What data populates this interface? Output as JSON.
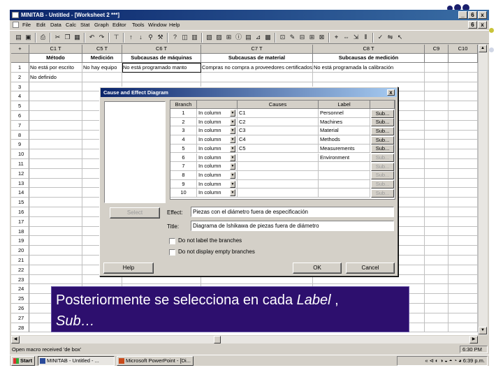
{
  "window": {
    "title": "MINITAB - Untitled - [Worksheet 2 ***]",
    "controls": [
      "_",
      "6",
      "x"
    ]
  },
  "menubar": {
    "items": [
      "File",
      "Edit",
      "Data",
      "Calc",
      "Stat",
      "Graph",
      "Editor",
      "Tools",
      "Window",
      "Help"
    ]
  },
  "worksheet": {
    "columns": [
      {
        "id": "C1 T",
        "name": "Método"
      },
      {
        "id": "C5 T",
        "name": "Medición"
      },
      {
        "id": "C6 T",
        "name": "Subcausas de máquinas"
      },
      {
        "id": "C7 T",
        "name": "Subcausas de material"
      },
      {
        "id": "C8 T",
        "name": "Subcausas de medición"
      },
      {
        "id": "C9",
        "name": ""
      },
      {
        "id": "C10",
        "name": ""
      }
    ],
    "corner": "+",
    "rows": [
      [
        "No está por escrito",
        "No hay equipo",
        "No está programado manto",
        "Compras no compra a proveedores certificados",
        "No está programada la calibración",
        "",
        ""
      ],
      [
        "No definido",
        "",
        "",
        "",
        "",
        "",
        ""
      ]
    ],
    "row_numbers": [
      "1",
      "2",
      "3",
      "4",
      "5",
      "6",
      "7",
      "8",
      "9",
      "10",
      "11",
      "12",
      "13",
      "14",
      "15",
      "16",
      "17",
      "18",
      "19",
      "20",
      "21",
      "22",
      "23",
      "24",
      "25",
      "26",
      "27",
      "28"
    ]
  },
  "dialog": {
    "title": "Cause and Effect Diagram",
    "headers": {
      "branch": "Branch",
      "causes": "Causes",
      "label": "Label"
    },
    "rows": [
      {
        "branch": "1",
        "mode": "In column",
        "cause": "C1",
        "label": "Personnel",
        "enabled": true
      },
      {
        "branch": "2",
        "mode": "In column",
        "cause": "C2",
        "label": "Machines",
        "enabled": true
      },
      {
        "branch": "3",
        "mode": "In column",
        "cause": "C3",
        "label": "Material",
        "enabled": true
      },
      {
        "branch": "4",
        "mode": "In column",
        "cause": "C4",
        "label": "Methods",
        "enabled": true
      },
      {
        "branch": "5",
        "mode": "In column",
        "cause": "C5",
        "label": "Measurements",
        "enabled": true
      },
      {
        "branch": "6",
        "mode": "In column",
        "cause": "",
        "label": "Environment",
        "enabled": false
      },
      {
        "branch": "7",
        "mode": "In column",
        "cause": "",
        "label": "",
        "enabled": false
      },
      {
        "branch": "8",
        "mode": "In column",
        "cause": "",
        "label": "",
        "enabled": false
      },
      {
        "branch": "9",
        "mode": "In column",
        "cause": "",
        "label": "",
        "enabled": false
      },
      {
        "branch": "10",
        "mode": "In column",
        "cause": "",
        "label": "",
        "enabled": false
      }
    ],
    "sub_label": "Sub...",
    "select_label": "Select",
    "effect_label": "Effect:",
    "effect_value": "Piezas con el diámetro fuera de especificación",
    "title_label": "Title:",
    "title_value": "Diagrama de Ishikawa de piezas fuera de diámetro",
    "check1": "Do not label the branches",
    "check2": "Do not display empty branches",
    "help_label": "Help",
    "ok_label": "OK",
    "cancel_label": "Cancel",
    "close_glyph": "x"
  },
  "statusbar": {
    "text": "Open macro received 'de box'",
    "right": "6:30 PM"
  },
  "taskbar": {
    "start": "Start",
    "tasks": [
      "MINITAB - Untitled - ...",
      "Microsoft PowerPoint - [Di..."
    ],
    "tray": "« ⊲ ◐ ◑ ◒ ◓ ◔ ◕  6:39 p.m."
  },
  "caption": {
    "line1_prefix": "Posteriormente se selecciona en cada ",
    "line1_italic": "Label",
    "line1_suffix": " ,",
    "line2_italic": "Sub…"
  },
  "colors": {
    "title_blue": "#0a246a",
    "caption_bg": "#2d0f6e",
    "window_gray": "#d4d0c8",
    "accent_dot": "#c9c43a"
  }
}
